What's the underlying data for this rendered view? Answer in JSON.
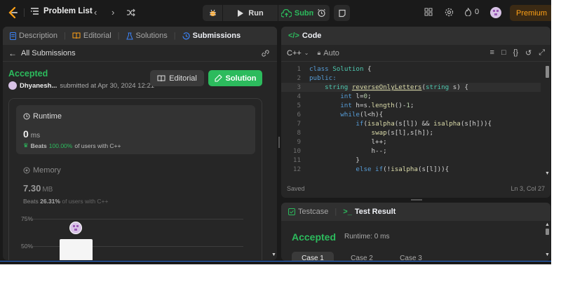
{
  "nav": {
    "problem_list": "Problem List",
    "run_label": "Run",
    "submit_label": "Submit",
    "streak_count": "0",
    "premium_label": "Premium"
  },
  "left_tabs": [
    {
      "label": "Description",
      "icon": "description-icon"
    },
    {
      "label": "Editorial",
      "icon": "book-icon"
    },
    {
      "label": "Solutions",
      "icon": "flask-icon"
    },
    {
      "label": "Submissions",
      "icon": "history-icon",
      "active": true
    }
  ],
  "submission": {
    "back_label": "All Submissions",
    "status": "Accepted",
    "user": "Dhyanesh...",
    "submitted_text": "submitted at Apr 30, 2024 12:21",
    "editorial_label": "Editorial",
    "solution_label": "Solution"
  },
  "runtime": {
    "title": "Runtime",
    "value": "0",
    "unit": "ms",
    "beats_label": "Beats",
    "beats_pct": "100.00%",
    "beats_suffix": "of users with C++"
  },
  "memory": {
    "title": "Memory",
    "value": "7.30",
    "unit": "MB",
    "beats_label": "Beats",
    "beats_pct": "26.31%",
    "beats_suffix": "of users with C++"
  },
  "distribution": {
    "tick_75": "75%",
    "tick_50": "50%"
  },
  "code": {
    "title": "Code",
    "language": "C++",
    "mode": "Auto",
    "saved_label": "Saved",
    "cursor_pos": "Ln 3, Col 27"
  },
  "code_lines": [
    {
      "n": "1"
    },
    {
      "n": "2"
    },
    {
      "n": "3"
    },
    {
      "n": "4"
    },
    {
      "n": "5"
    },
    {
      "n": "6"
    },
    {
      "n": "7"
    },
    {
      "n": "8"
    },
    {
      "n": "9"
    },
    {
      "n": "10"
    },
    {
      "n": "11"
    },
    {
      "n": "12"
    }
  ],
  "code_text": {
    "l1a": "class",
    "l1b": "Solution",
    "l1c": " {",
    "l2": "public:",
    "l3a": "string",
    "l3b": "reverseOnlyLetters",
    "l3c": "(",
    "l3d": "string",
    "l3e": " s) {",
    "l4a": "int",
    "l4b": " l=",
    "l4c": "0",
    "l4d": ";",
    "l5a": "int",
    "l5b": " h=s.",
    "l5c": "length",
    "l5d": "()-",
    "l5e": "1",
    "l5f": ";",
    "l6a": "while",
    "l6b": "(l<h){",
    "l7a": "if",
    "l7b": "(",
    "l7c": "isalpha",
    "l7d": "(s[l]) && ",
    "l7e": "isalpha",
    "l7f": "(s[h])){",
    "l8a": "swap",
    "l8b": "(s[l],s[h]);",
    "l9": "l++;",
    "l10": "h--;",
    "l11": "}",
    "l12a": "else if",
    "l12b": "(!",
    "l12c": "isalpha",
    "l12d": "(s[l])){"
  },
  "result": {
    "testcase_label": "Testcase",
    "result_label": "Test Result",
    "status": "Accepted",
    "runtime": "Runtime: 0 ms",
    "case1": "Case 1",
    "case2": "Case 2",
    "case3": "Case 3"
  },
  "colors": {
    "accent_green": "#2cbb5d",
    "premium_orange": "#ffa116",
    "panel_bg": "#262626",
    "app_bg": "#1a1a1a"
  }
}
